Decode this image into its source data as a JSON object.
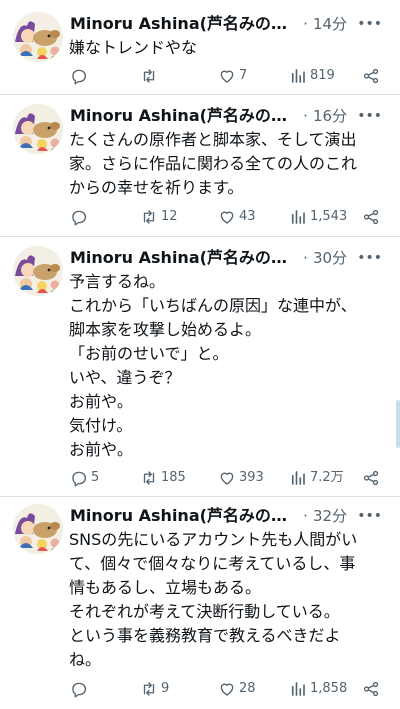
{
  "tweets": [
    {
      "author": "Minoru Ashina(芦名みのる...",
      "sep": "·",
      "time": "14分",
      "lines": [
        "嫌なトレンドやな"
      ],
      "reply_count": "",
      "retweet_count": "",
      "like_count": "7",
      "view_count": "819"
    },
    {
      "author": "Minoru Ashina(芦名みのる...",
      "sep": "·",
      "time": "16分",
      "lines": [
        "たくさんの原作者と脚本家、そして演出",
        "家。さらに作品に関わる全ての人のこれ",
        "からの幸せを祈ります。"
      ],
      "reply_count": "",
      "retweet_count": "12",
      "like_count": "43",
      "view_count": "1,543"
    },
    {
      "author": "Minoru Ashina(芦名みのる...",
      "sep": "·",
      "time": "30分",
      "lines": [
        "予言するね。",
        "これから「いちばんの原因」な連中が、",
        "脚本家を攻撃し始めるよ。",
        "「お前のせいで」と。",
        "いや、違うぞ？",
        "お前や。",
        "気付け。",
        "お前や。"
      ],
      "reply_count": "5",
      "retweet_count": "185",
      "like_count": "393",
      "view_count": "7.2万"
    },
    {
      "author": "Minoru Ashina(芦名みのる...",
      "sep": "·",
      "time": "32分",
      "lines": [
        "SNSの先にいるアカウント先も人間がい",
        "て、個々で個々なりに考えているし、事",
        "情もあるし、立場もある。",
        "それぞれが考えて決断行動している。",
        "という事を義務教育で教えるべきだよ",
        "ね。"
      ],
      "reply_count": "",
      "retweet_count": "9",
      "like_count": "28",
      "view_count": "1,858"
    }
  ],
  "icons": {
    "reply": "reply-icon",
    "retweet": "retweet-icon",
    "like": "heart-icon",
    "views": "views-icon",
    "share": "share-icon",
    "more": "more-icon"
  },
  "colors": {
    "text": "#0f1419",
    "secondary": "#536471",
    "divider": "#dfe3e7",
    "scrollbar": "#c7ddec"
  }
}
